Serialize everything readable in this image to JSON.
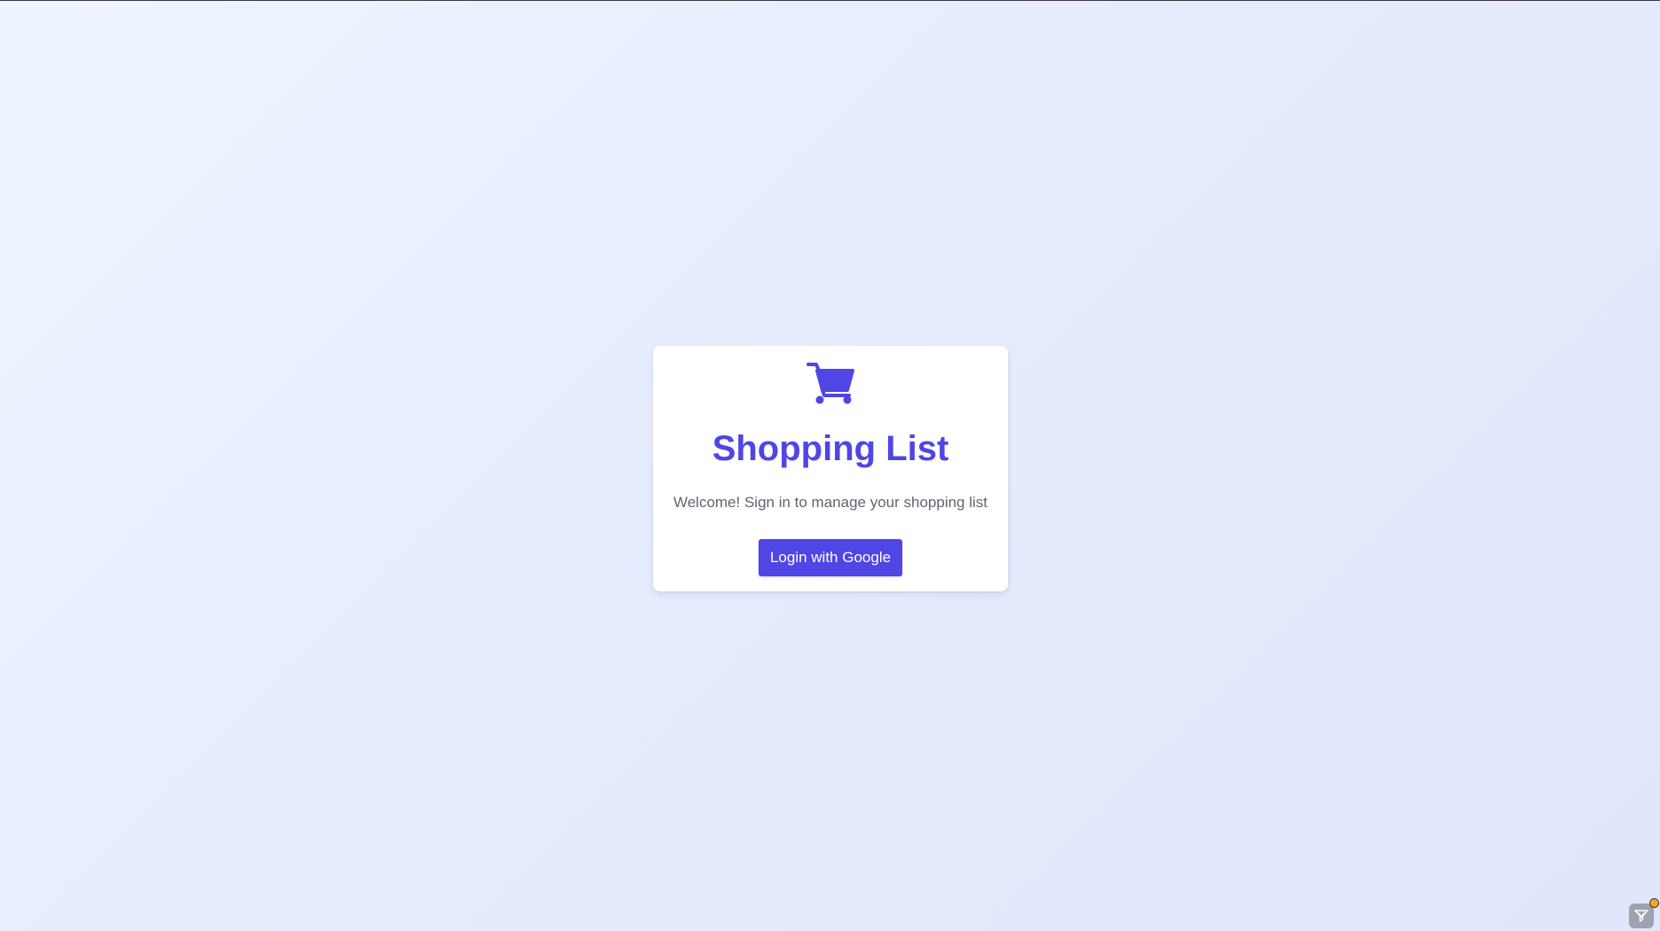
{
  "login_card": {
    "icon": "shopping-cart-icon",
    "title": "Shopping List",
    "subtitle": "Welcome! Sign in to manage your shopping list",
    "login_button_label": "Login with Google"
  },
  "colors": {
    "accent": "#4f46e5",
    "subtitle_text": "#5f6470",
    "card_background": "#ffffff",
    "page_background": "#e6ebfd",
    "corner_badge": "#f5a623"
  },
  "corner_widget": {
    "icon": "download-filter-icon"
  }
}
